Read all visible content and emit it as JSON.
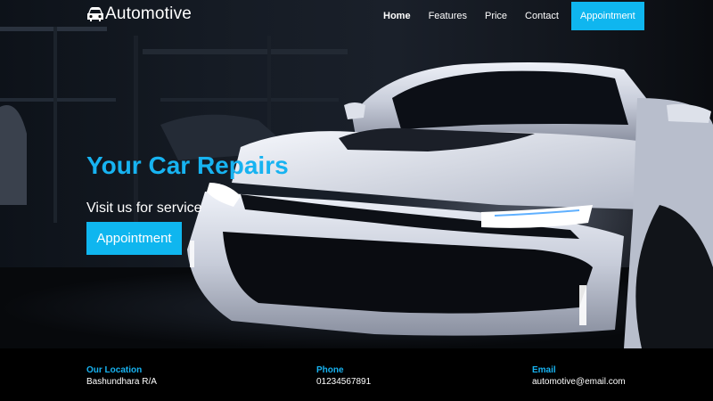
{
  "brand": {
    "name": "Automotive",
    "icon": "car-icon"
  },
  "nav": {
    "items": [
      {
        "label": "Home"
      },
      {
        "label": "Features"
      },
      {
        "label": "Price"
      },
      {
        "label": "Contact"
      }
    ],
    "cta_label": "Appointment"
  },
  "hero": {
    "title": "Your Car Repairs",
    "subtitle": "Visit us for service",
    "button_label": "Appointment"
  },
  "footer": {
    "location": {
      "label": "Our Location",
      "value": "Bashundhara R/A"
    },
    "phone": {
      "label": "Phone",
      "value": "01234567891"
    },
    "email": {
      "label": "Email",
      "value": "automotive@email.com"
    }
  },
  "colors": {
    "accent": "#0fb6ef",
    "background": "#000000",
    "text": "#ffffff"
  }
}
